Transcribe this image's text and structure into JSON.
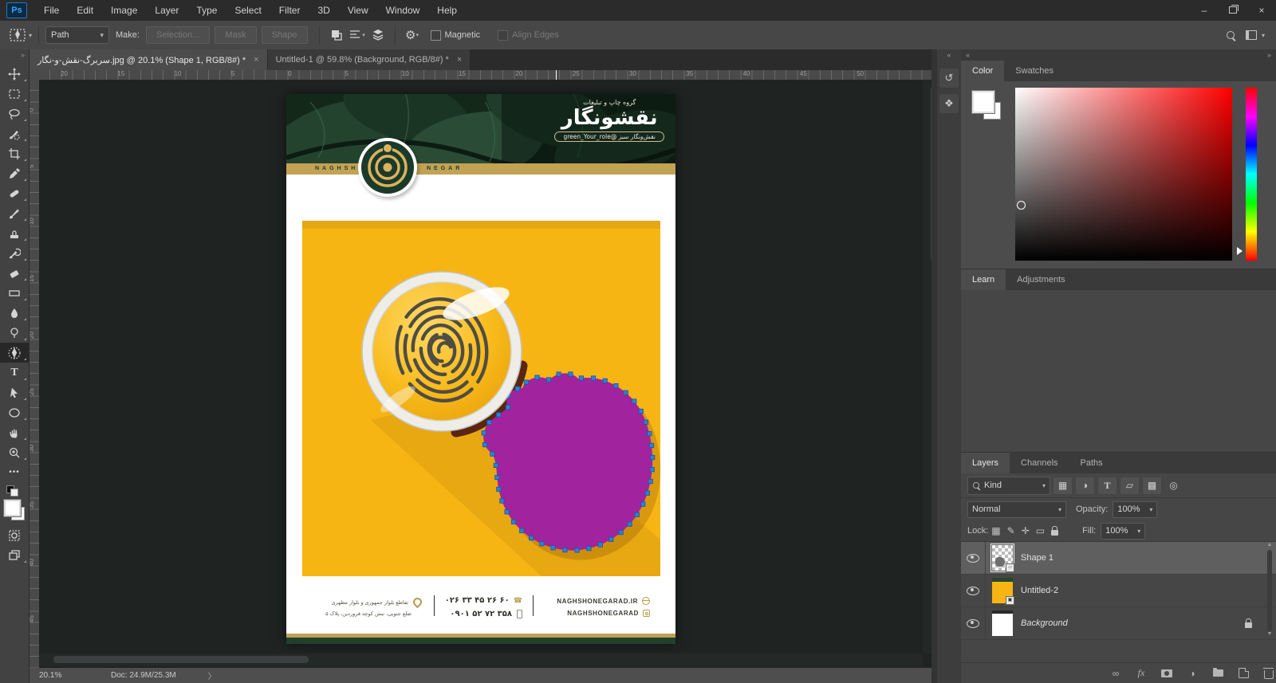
{
  "menubar": {
    "logo": "Ps",
    "items": [
      "File",
      "Edit",
      "Image",
      "Layer",
      "Type",
      "Select",
      "Filter",
      "3D",
      "View",
      "Window",
      "Help"
    ]
  },
  "options": {
    "path_value": "Path",
    "make_label": "Make:",
    "selection_button": "Selection...",
    "mask_button": "Mask",
    "shape_button": "Shape",
    "magnetic_label": "Magnetic",
    "align_edges_label": "Align Edges"
  },
  "tabs": [
    {
      "title": "سربرگ-نقش-و-نگار.jpg @ 20.1% (Shape 1, RGB/8#) *",
      "close": "×"
    },
    {
      "title": "Untitled-1 @ 59.8% (Background, RGB/8#) *",
      "close": "×"
    }
  ],
  "rulers": {
    "horizontal": [
      "20",
      "15",
      "10",
      "5",
      "0",
      "5",
      "10",
      "15",
      "20",
      "25",
      "30",
      "35",
      "40",
      "45",
      "50"
    ],
    "vertical": [
      "0",
      "5",
      "10",
      "15",
      "20",
      "25",
      "30",
      "35",
      "40",
      "45"
    ]
  },
  "poster": {
    "brand_small": "گروه چاپ و تبلیغات",
    "brand_name": "نقشونگار",
    "brand_pill": "نقش‌ونگار سبز @green_Your_role",
    "band_left": "NAGHSH",
    "band_right": "NEGAR",
    "footer": {
      "website": "NAGHSHONEGARAD.IR",
      "instagram": "NAGHSHONEGARAD",
      "phone1": "۰۲۶ ۳۳ ۴۵ ۲۶ ۶۰",
      "phone2": "۰۹۰۱ ۵۲ ۷۲ ۳۵۸",
      "address1": "تقاطع بلوار جمهوری و بلوار مطهری",
      "address2": "ضلع جنوبی، نبش کوچه فروردین، پلاک ۵"
    }
  },
  "panels": {
    "color": {
      "tabs": [
        "Color",
        "Swatches"
      ]
    },
    "learn": {
      "tabs": [
        "Learn",
        "Adjustments"
      ]
    },
    "layers": {
      "tabs": [
        "Layers",
        "Channels",
        "Paths"
      ],
      "filter_kind": "Kind",
      "blend_mode": "Normal",
      "opacity_label": "Opacity:",
      "opacity_value": "100%",
      "lock_label": "Lock:",
      "fill_label": "Fill:",
      "fill_value": "100%",
      "items": [
        {
          "name": "Shape 1"
        },
        {
          "name": "Untitled-2"
        },
        {
          "name": "Background"
        }
      ]
    }
  },
  "statusbar": {
    "zoom": "20.1%",
    "doc": "Doc: 24.9M/25.3M"
  },
  "colors": {
    "card_yellow": "#f7b514",
    "blob_magenta": "#a1249e",
    "anchor_blue": "#2f7fd6",
    "gold_band": "#c2a253",
    "leaf_green": "#1c3a28"
  }
}
